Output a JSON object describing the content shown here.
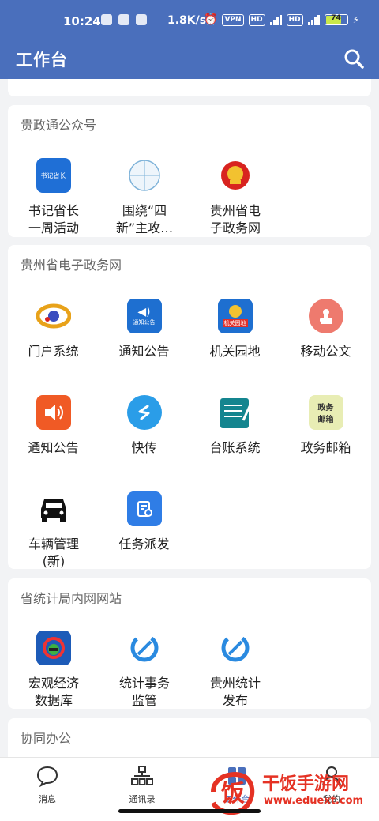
{
  "status_bar": {
    "time": "10:24",
    "net_speed": "1.8K/s",
    "vpn": "VPN",
    "hd": "HD",
    "battery": "74"
  },
  "app_bar": {
    "title": "工作台"
  },
  "sections": [
    {
      "title": "贵政通公众号",
      "items": [
        {
          "label": "书记省长一周活动",
          "icon": "weekly-activity-icon"
        },
        {
          "label": "围绕“四新”主攻…",
          "icon": "four-new-icon"
        },
        {
          "label": "贵州省电子政务网",
          "icon": "national-emblem-icon"
        }
      ]
    },
    {
      "title": "贵州省电子政务网",
      "items": [
        {
          "label": "门户系统",
          "icon": "portal-icon"
        },
        {
          "label": "通知公告",
          "icon": "notice-board-icon"
        },
        {
          "label": "机关园地",
          "icon": "garden-icon"
        },
        {
          "label": "移动公文",
          "icon": "stamp-icon"
        },
        {
          "label": "通知公告",
          "icon": "speaker-icon"
        },
        {
          "label": "快传",
          "icon": "quick-transfer-icon"
        },
        {
          "label": "台账系统",
          "icon": "ledger-icon"
        },
        {
          "label": "政务邮箱",
          "icon": "mailbox-icon"
        },
        {
          "label": "车辆管理(新)",
          "icon": "car-icon"
        },
        {
          "label": "任务派发",
          "icon": "task-icon"
        }
      ]
    },
    {
      "title": "省统计局内网网站",
      "items": [
        {
          "label": "宏观经济数据库",
          "icon": "macro-economy-icon"
        },
        {
          "label": "统计事务监管",
          "icon": "statistics-icon"
        },
        {
          "label": "贵州统计发布",
          "icon": "statistics-release-icon"
        }
      ]
    },
    {
      "title": "协同办公",
      "items": []
    }
  ],
  "icon_texts": {
    "weekly": "书记省长",
    "notice": "通知公告",
    "garden": "机关园地",
    "mailbox_1": "政务",
    "mailbox_2": "邮箱"
  },
  "tabs": [
    {
      "label": "消息",
      "icon": "chat-icon"
    },
    {
      "label": "通讯录",
      "icon": "org-chart-icon"
    },
    {
      "label": "工作台",
      "icon": "grid-icon"
    },
    {
      "label": "我的",
      "icon": "user-icon"
    }
  ],
  "watermark": {
    "text": "干饭手游网",
    "url": "www.eduext.com",
    "logo_char": "饭"
  },
  "colors": {
    "primary": "#4a6fbc",
    "accent_red": "#e53224"
  }
}
